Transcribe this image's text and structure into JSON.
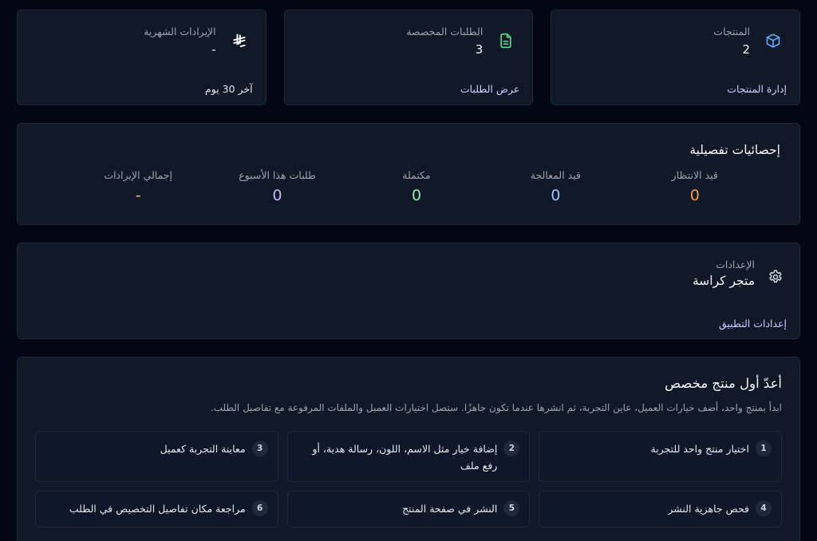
{
  "top_cards": [
    {
      "label": "المنتجات",
      "value": "2",
      "link": "إدارة المنتجات",
      "icon": "cube-icon"
    },
    {
      "label": "الطلبات المخصصة",
      "value": "3",
      "link": "عرض الطلبات",
      "icon": "document-icon"
    },
    {
      "label": "الإيرادات الشهرية",
      "value": "-",
      "link": "آخر 30 يوم",
      "icon": "riyal-icon"
    }
  ],
  "stats": {
    "title": "إحصائيات تفصيلية",
    "items": [
      {
        "label": "قيد الانتظار",
        "value": "0",
        "color": "#fb923c"
      },
      {
        "label": "قيد المعالجة",
        "value": "0",
        "color": "#93c5fd"
      },
      {
        "label": "مكتملة",
        "value": "0",
        "color": "#86efac"
      },
      {
        "label": "طلبات هذا الأسبوع",
        "value": "0",
        "color": "#c4b5fd"
      },
      {
        "label": "إجمالي الإيرادات",
        "value": "-",
        "color": "#facc15"
      }
    ]
  },
  "settings": {
    "label": "الإعدادات",
    "value": "متجر كراسة",
    "link": "إعدادات التطبيق",
    "icon": "gear-icon"
  },
  "onboarding": {
    "title": "أعدّ أول منتج مخصص",
    "description": "ابدأ بمنتج واحد، أضف خيارات العميل، عاين التجربة، ثم انشرها عندما تكون جاهزًا. ستصل اختيارات العميل والملفات المرفوعة مع تفاصيل الطلب.",
    "steps": [
      {
        "num": "1",
        "text": "اختيار منتج واحد للتجربة"
      },
      {
        "num": "2",
        "text": "إضافة خيار مثل الاسم، اللون، رسالة هدية، أو رفع ملف"
      },
      {
        "num": "3",
        "text": "معاينة التجربة كعميل"
      },
      {
        "num": "4",
        "text": "فحص جاهزية النشر"
      },
      {
        "num": "5",
        "text": "النشر في صفحة المنتج"
      },
      {
        "num": "6",
        "text": "مراجعة مكان تفاصيل التخصيص في الطلب"
      }
    ]
  },
  "colors": {
    "background": "#030712",
    "card": "#111827",
    "cube_icon": "#60a5fa",
    "document_icon": "#4ade80",
    "riyal_icon": "#ffffff"
  }
}
